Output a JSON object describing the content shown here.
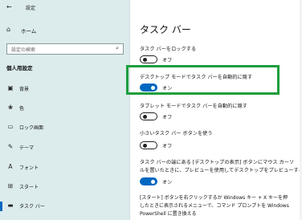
{
  "window": {
    "title": "設定"
  },
  "sidebar": {
    "home_label": "ホーム",
    "search_placeholder": "設定の検索",
    "section_heading": "個人用設定",
    "items": [
      {
        "label": "背景",
        "icon": "image-icon"
      },
      {
        "label": "色",
        "icon": "palette-icon"
      },
      {
        "label": "ロック画面",
        "icon": "lock-screen-icon"
      },
      {
        "label": "テーマ",
        "icon": "theme-brush-icon"
      },
      {
        "label": "フォント",
        "icon": "font-icon"
      },
      {
        "label": "スタート",
        "icon": "start-icon"
      },
      {
        "label": "タスク バー",
        "icon": "taskbar-icon",
        "active": true
      }
    ]
  },
  "main": {
    "title": "タスク バー",
    "settings": [
      {
        "label": "タスク バーをロックする",
        "state": "オフ",
        "on": false
      },
      {
        "label": "デスクトップ モードでタスク バーを自動的に隠す",
        "state": "オン",
        "on": true
      },
      {
        "label": "タブレット モードでタスク バーを自動的に隠す",
        "state": "オフ",
        "on": false
      },
      {
        "label": "小さいタスク バー ボタンを使う",
        "state": "オフ",
        "on": false
      },
      {
        "label_line1": "タスク バーの端にある [デスクトップの表示] ボタンにマウス カーソ",
        "label_line2": "ルを置いたときに、プレビューを使用してデスクトップをプレビューする",
        "state": "オン",
        "on": true
      }
    ],
    "info_lines": [
      "[スタート] ボタンを右クリックするか Windows キー + X キーを押",
      "したときに表示されるメニューで、コマンド プロンプトを Windows",
      "PowerShell に置き換える"
    ]
  },
  "colors": {
    "accent": "#0067c0",
    "highlight": "#1e9e3e",
    "sidebar_bg": "#dcebec"
  }
}
